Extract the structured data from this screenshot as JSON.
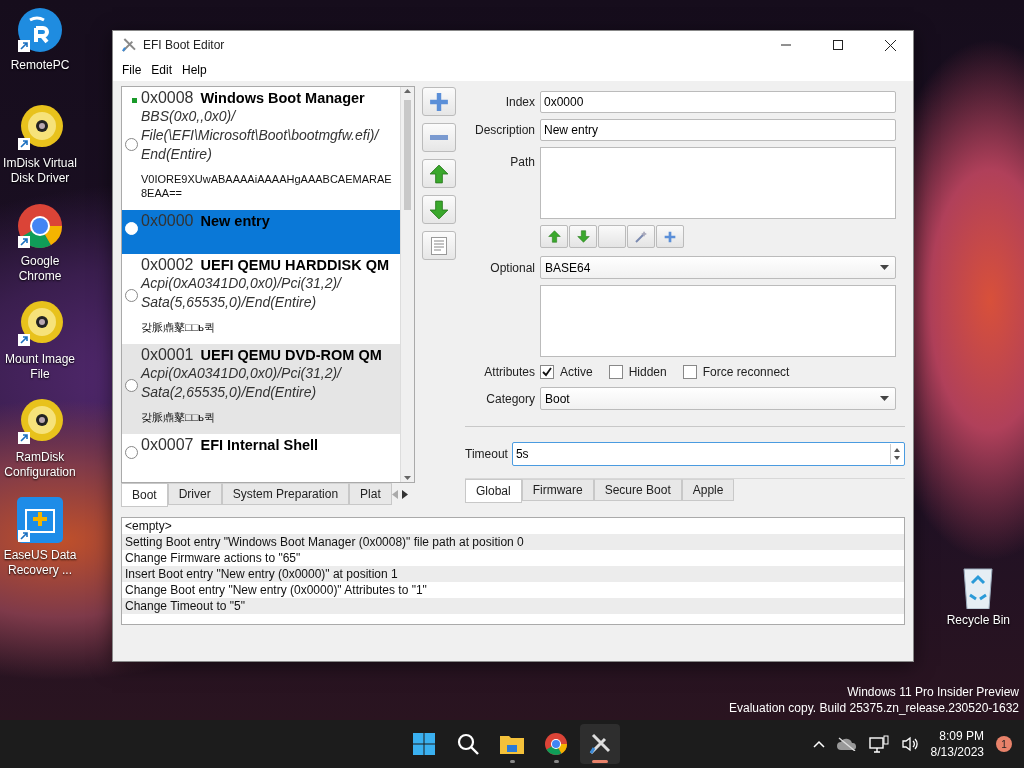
{
  "desktop_icons": [
    {
      "label": "RemotePC",
      "kind": "remote"
    },
    {
      "label": "ImDisk Virtual Disk Driver",
      "kind": "disc"
    },
    {
      "label": "Google Chrome",
      "kind": "chrome"
    },
    {
      "label": "Mount Image File",
      "kind": "disc"
    },
    {
      "label": "RamDisk Configuration",
      "kind": "disc"
    },
    {
      "label": "EaseUS Data Recovery ...",
      "kind": "case"
    }
  ],
  "recycle_bin": {
    "label": "Recycle Bin"
  },
  "window": {
    "title": "EFI Boot Editor"
  },
  "menu": [
    "File",
    "Edit",
    "Help"
  ],
  "boot_entries": [
    {
      "index": "0x0008",
      "title": "Windows Boot Manager",
      "path": [
        "BBS(0x0,,0x0)/",
        "File(\\EFI\\Microsoft\\Boot\\bootmgfw.efi)/",
        "End(Entire)"
      ],
      "optional": [
        "V0IORE9XUwABAAAAiAAAAHgAAABCAEMARAE",
        "8EAA=="
      ],
      "active": true,
      "selected": false,
      "hovered": false
    },
    {
      "index": "0x0000",
      "title": "New entry",
      "active": false,
      "selected": true,
      "hovered": false
    },
    {
      "index": "0x0002",
      "title": "UEFI QEMU HARDDISK QM",
      "path": [
        "Acpi(0xA0341D0,0x0)/Pci(31,2)/",
        "Sata(5,65535,0)/End(Entire)"
      ],
      "optional": [
        "갖脈鼑鼕□□ь퀵"
      ],
      "active": false,
      "selected": false,
      "hovered": false
    },
    {
      "index": "0x0001",
      "title": "UEFI QEMU DVD-ROM QM",
      "path": [
        "Acpi(0xA0341D0,0x0)/Pci(31,2)/",
        "Sata(2,65535,0)/End(Entire)"
      ],
      "optional": [
        "갖脈鼑鼕□□ь퀵"
      ],
      "active": false,
      "selected": false,
      "hovered": true
    },
    {
      "index": "0x0007",
      "title": "EFI Internal Shell",
      "active": false,
      "selected": false,
      "hovered": false
    }
  ],
  "list_tabs": [
    {
      "label": "Boot",
      "selected": true
    },
    {
      "label": "Driver",
      "selected": false
    },
    {
      "label": "System Preparation",
      "selected": false
    },
    {
      "label": "Plat",
      "selected": false
    }
  ],
  "form": {
    "index": {
      "label": "Index",
      "value": "0x0000"
    },
    "description": {
      "label": "Description",
      "value": "New entry"
    },
    "path": {
      "label": "Path"
    },
    "optional": {
      "label": "Optional",
      "value": "BASE64"
    },
    "attributes": {
      "label": "Attributes",
      "options": [
        {
          "label": "Active",
          "checked": true
        },
        {
          "label": "Hidden",
          "checked": false
        },
        {
          "label": "Force reconnect",
          "checked": false
        }
      ]
    },
    "category": {
      "label": "Category",
      "value": "Boot"
    },
    "timeout": {
      "label": "Timeout",
      "value": "5s"
    }
  },
  "settings_tabs": [
    {
      "label": "Global",
      "selected": true
    },
    {
      "label": "Firmware",
      "selected": false
    },
    {
      "label": "Secure Boot",
      "selected": false
    },
    {
      "label": "Apple",
      "selected": false
    }
  ],
  "log": [
    "<empty>",
    "Setting Boot entry \"Windows Boot Manager (0x0008)\" file path at position 0",
    "Change Firmware actions to \"65\"",
    "Insert Boot entry \"New entry (0x0000)\" at position 1",
    "Change Boot entry \"New entry (0x0000)\" Attributes to \"1\"",
    "Change Timeout to \"5\""
  ],
  "watermark_lines": [
    "Windows 11 Pro Insider Preview",
    "Evaluation copy. Build 25375.zn_release.230520-1632"
  ],
  "taskbar": {
    "apps": [
      {
        "kind": "start",
        "running": false,
        "active": false
      },
      {
        "kind": "search",
        "running": false,
        "active": false
      },
      {
        "kind": "folder",
        "running": true,
        "active": false
      },
      {
        "kind": "chrome",
        "running": true,
        "active": false
      },
      {
        "kind": "tools",
        "running": true,
        "active": true
      }
    ],
    "time": "8:09 PM",
    "date": "8/13/2023",
    "badge": "1"
  }
}
